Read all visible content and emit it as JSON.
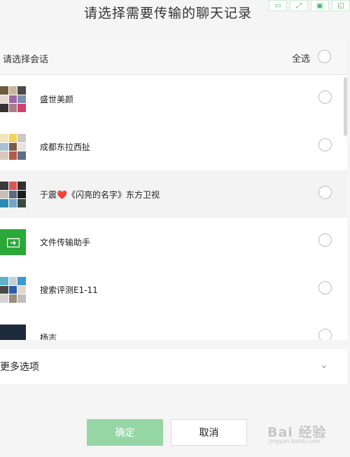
{
  "dialog": {
    "title": "请选择需要传输的聊天记录"
  },
  "header": {
    "label": "请选择会话",
    "select_all": "全选"
  },
  "chats": [
    {
      "name": "盛世美颜"
    },
    {
      "name": "成都东拉西扯"
    },
    {
      "name_pre": "于震",
      "name_post": "《闪亮的名字》东方卫视"
    },
    {
      "name": "文件传输助手"
    },
    {
      "name": "搜索评测E1-11"
    },
    {
      "name": "杨志"
    }
  ],
  "more_options": {
    "label": "更多选项"
  },
  "buttons": {
    "confirm": "确定",
    "cancel": "取消"
  },
  "watermark": {
    "text": "Bai 经验",
    "sub": "jingyan.baidu.com"
  },
  "colors": {
    "accent": "#95d6a4",
    "file_helper": "#2aa838"
  },
  "icons": [
    "minimize-icon",
    "maximize-icon",
    "save-icon",
    "restore-icon",
    "file-transfer-icon",
    "heart-icon",
    "chevron-down-icon"
  ]
}
